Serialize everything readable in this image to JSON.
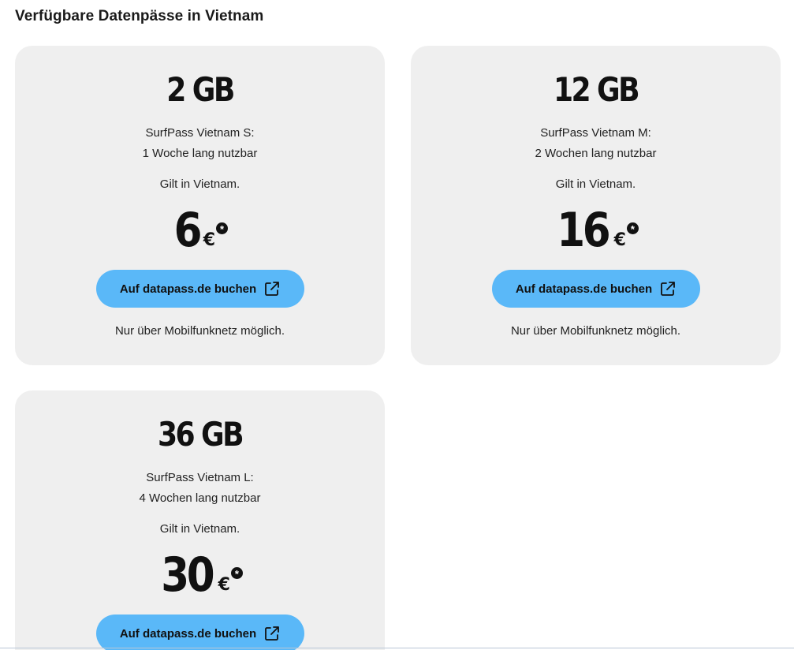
{
  "section": {
    "title": "Verfügbare Datenpässe in Vietnam"
  },
  "passes": [
    {
      "volume": "2 GB",
      "name": "SurfPass Vietnam S:",
      "duration": "1 Woche lang nutzbar",
      "validity": "Gilt in Vietnam.",
      "price": "6",
      "currency": "€",
      "price_marker": "*",
      "button_label": "Auf datapass.de buchen",
      "note": "Nur über Mobilfunknetz möglich."
    },
    {
      "volume": "12 GB",
      "name": "SurfPass Vietnam M:",
      "duration": "2 Wochen lang nutzbar",
      "validity": "Gilt in Vietnam.",
      "price": "16",
      "currency": "€",
      "price_marker": "*",
      "button_label": "Auf datapass.de buchen",
      "note": "Nur über Mobilfunknetz möglich."
    },
    {
      "volume": "36 GB",
      "name": "SurfPass Vietnam L:",
      "duration": "4 Wochen lang nutzbar",
      "validity": "Gilt in Vietnam.",
      "price": "30",
      "currency": "€",
      "price_marker": "*",
      "button_label": "Auf datapass.de buchen"
    }
  ],
  "icons": {
    "button_icon": "external-link-icon"
  },
  "colors": {
    "card_background": "#efefef",
    "button_background": "#5ab8f8",
    "text": "#1a1a1a"
  }
}
